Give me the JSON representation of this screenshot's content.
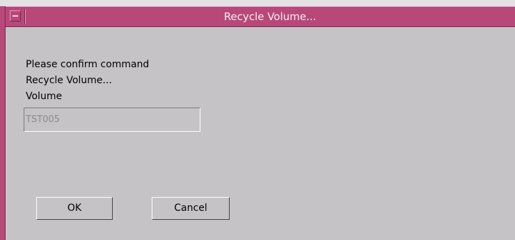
{
  "window": {
    "title": "Recycle Volume..."
  },
  "dialog": {
    "prompt": "Please confirm command",
    "command": "Recycle Volume...",
    "field_label": "Volume",
    "volume_value": "TST005"
  },
  "buttons": {
    "ok_label": "OK",
    "cancel_label": "Cancel"
  },
  "colors": {
    "titlebar": "#b8487a",
    "dialog_background": "#c6c3c6",
    "title_text": "#f7eef3"
  },
  "icons": {
    "window_menu": "window-menu-icon"
  }
}
